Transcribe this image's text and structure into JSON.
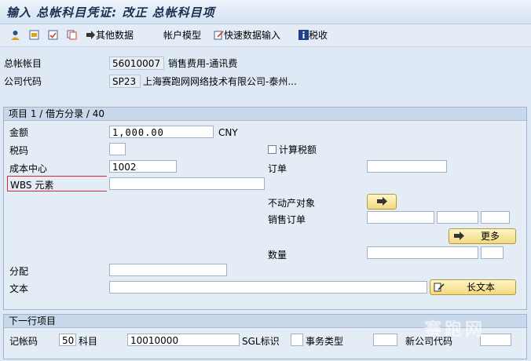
{
  "title": "输入 总帐科目凭证: 改正 总帐科目项",
  "toolbar": {
    "other_data": "其他数据",
    "account_model": "帐户模型",
    "fast_entry": "快速数据输入",
    "tax": "税收"
  },
  "header": {
    "gl_account_label": "总帐帐目",
    "gl_account_value": "56010007",
    "gl_account_desc": "销售费用-通讯费",
    "company_code_label": "公司代码",
    "company_code_value": "SP23",
    "company_code_desc": "上海赛跑网网络技术有限公司-泰州..."
  },
  "item_group": {
    "heading": "项目 1 / 借方分录 / 40",
    "amount_label": "金额",
    "amount_value": "1,000.00",
    "currency": "CNY",
    "tax_code_label": "税码",
    "tax_code_value": "",
    "calc_tax_label": "计算税额",
    "cost_center_label": "成本中心",
    "cost_center_value": "1002",
    "order_label": "订单",
    "order_value": "",
    "wbs_label": "WBS 元素",
    "wbs_value": "",
    "real_estate_label": "不动产对象",
    "sales_order_label": "销售订单",
    "more_button": "更多",
    "quantity_label": "数量",
    "assignment_label": "分配",
    "assignment_value": "",
    "text_label": "文本",
    "text_value": "",
    "long_text_button": "长文本"
  },
  "next_item": {
    "heading": "下一行项目",
    "posting_key_label": "记帐码",
    "posting_key_value": "50",
    "account_label": "科目",
    "account_value": "10010000",
    "sgl_label": "SGL标识",
    "sgl_value": "",
    "trans_type_label": "事务类型",
    "trans_type_value": "",
    "new_company_label": "新公司代码",
    "new_company_value": ""
  },
  "watermark": "赛跑网"
}
